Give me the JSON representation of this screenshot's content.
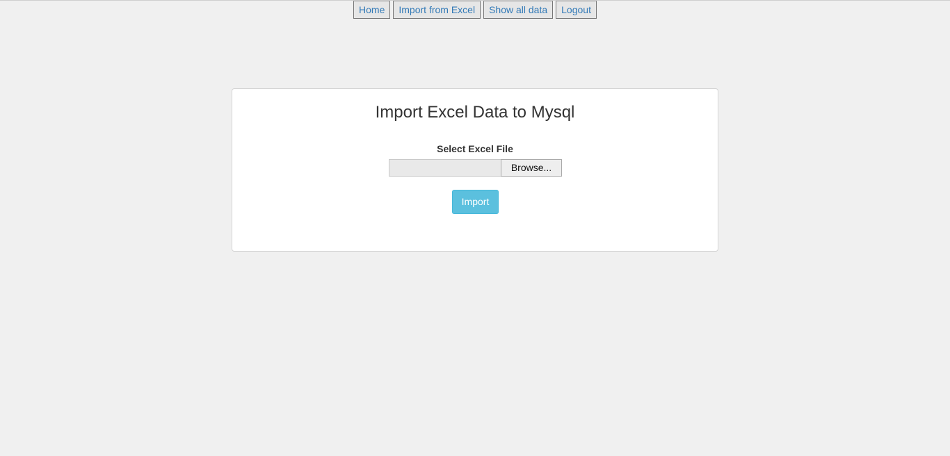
{
  "nav": {
    "items": [
      {
        "label": "Home"
      },
      {
        "label": "Import from Excel"
      },
      {
        "label": "Show all data"
      },
      {
        "label": "Logout"
      }
    ]
  },
  "form": {
    "title": "Import Excel Data to Mysql",
    "file_label": "Select Excel File",
    "file_value": "",
    "browse_label": "Browse...",
    "import_label": "Import"
  },
  "colors": {
    "page_background": "#f0f0f0",
    "link": "#337ab7",
    "import_button": "#5bc0de"
  }
}
